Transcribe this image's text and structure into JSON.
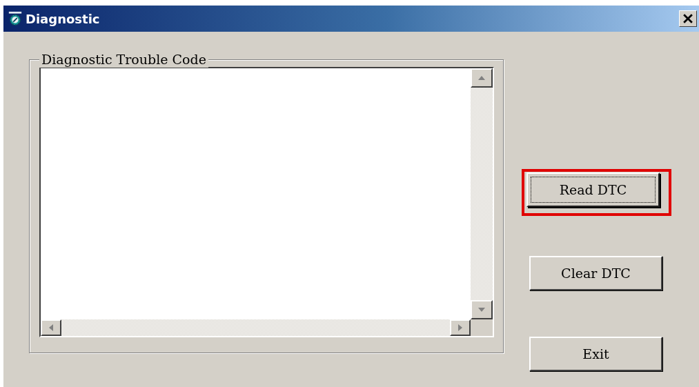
{
  "window": {
    "title": "Diagnostic"
  },
  "group": {
    "legend": "Diagnostic Trouble Code"
  },
  "buttons": [
    {
      "label": "Read DTC",
      "focused": true,
      "highlighted": true
    },
    {
      "label": "Clear DTC",
      "focused": false,
      "highlighted": false
    },
    {
      "label": "Exit",
      "focused": false,
      "highlighted": false
    }
  ]
}
